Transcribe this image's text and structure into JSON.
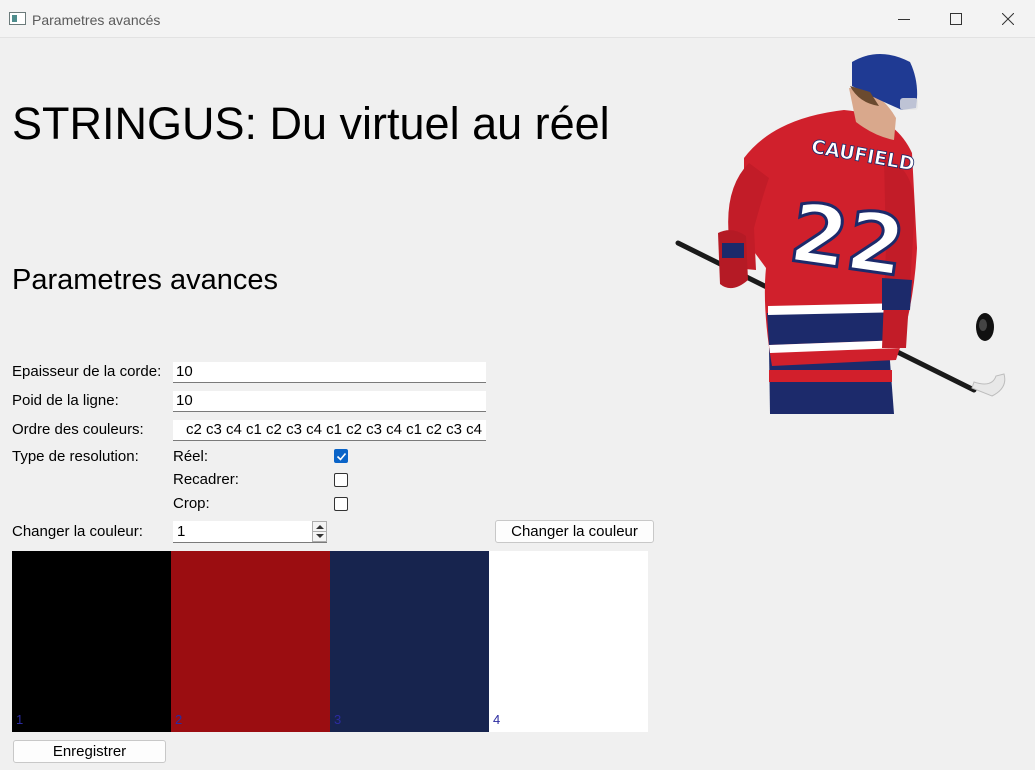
{
  "window": {
    "title": "Parametres avancés"
  },
  "header": {
    "title": "STRINGUS: Du virtuel au réel",
    "section": "Parametres avances"
  },
  "form": {
    "thickness_label": "Epaisseur de la corde:",
    "thickness_value": "10",
    "weight_label": "Poid de la ligne:",
    "weight_value": "10",
    "order_label": "Ordre des couleurs:",
    "order_value": "c2 c3 c4 c1 c2 c3 c4 c1 c2 c3 c4 c1 c2 c3 c4",
    "resolution_label": "Type de resolution:",
    "options": [
      {
        "label": "Réel:",
        "checked": true
      },
      {
        "label": "Recadrer:",
        "checked": false
      },
      {
        "label": "Crop:",
        "checked": false
      }
    ],
    "change_color_label": "Changer la couleur:",
    "change_color_value": "1",
    "change_color_button": "Changer la couleur"
  },
  "palette": [
    {
      "number": "1",
      "color": "#000000"
    },
    {
      "number": "2",
      "color": "#9b0d11"
    },
    {
      "number": "3",
      "color": "#17244e"
    },
    {
      "number": "4",
      "color": "#ffffff"
    }
  ],
  "save_button": "Enregistrer",
  "image": {
    "jersey_name": "CAUFIELD",
    "jersey_number": "22"
  }
}
